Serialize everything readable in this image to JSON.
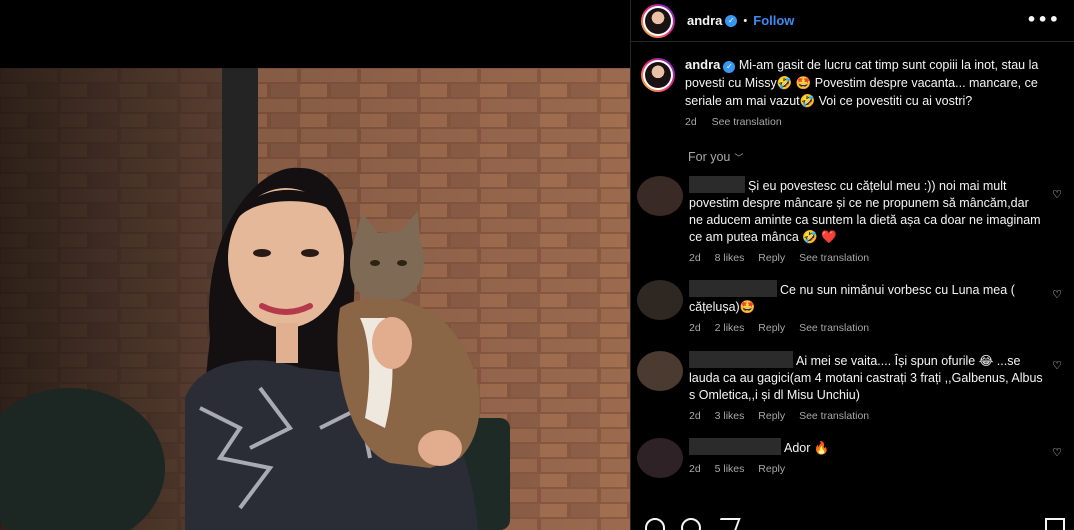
{
  "post": {
    "username": "andra",
    "verified_mark": "✓",
    "separator": "•",
    "follow_label": "Follow",
    "more_label": "•••"
  },
  "caption": {
    "username": "andra",
    "text": " Mi-am gasit de lucru cat timp sunt copiii la inot, stau la povesti cu Missy🤣 🤩 Povestim despre vacanta... mancare, ce seriale am mai vazut🤣  Voi ce povestiti cu ai vostri?",
    "age": "2d",
    "translate": "See translation"
  },
  "section_label": "For you",
  "section_chevron": "﹀",
  "comments": [
    {
      "text": "Și eu povestesc cu cățelul meu :)) noi mai mult povestim despre mâncare și ce ne propunem să mâncăm,dar ne aducem aminte ca suntem la dietă așa ca doar ne imaginam ce am putea mânca 🤣 ❤️",
      "age": "2d",
      "likes": "8 likes",
      "reply": "Reply",
      "translate": "See translation"
    },
    {
      "text": "Ce nu sun nimănui vorbesc cu Luna mea ( cățelușa)🤩",
      "age": "2d",
      "likes": "2 likes",
      "reply": "Reply",
      "translate": "See translation"
    },
    {
      "text": "Ai mei se vaita.... Își spun ofurile 😂  ...se lauda ca au gagici(am 4 motani castrați 3 frați ,,Galbenus, Albus s Omletica,,i și dl Misu Unchiu)",
      "age": "2d",
      "likes": "3 likes",
      "reply": "Reply",
      "translate": "See translation"
    },
    {
      "text": "Ador 🔥",
      "age": "2d",
      "likes": "5 likes",
      "reply": "Reply",
      "translate": ""
    }
  ],
  "icons": {
    "heart": "♡",
    "verified": "verified-badge-icon",
    "more": "more-options-icon"
  },
  "colors": {
    "background": "#000000",
    "link_blue": "#3f8bf0",
    "muted": "#a8a8a8",
    "verified": "#3897f0",
    "heart_red": "#ed4956"
  }
}
